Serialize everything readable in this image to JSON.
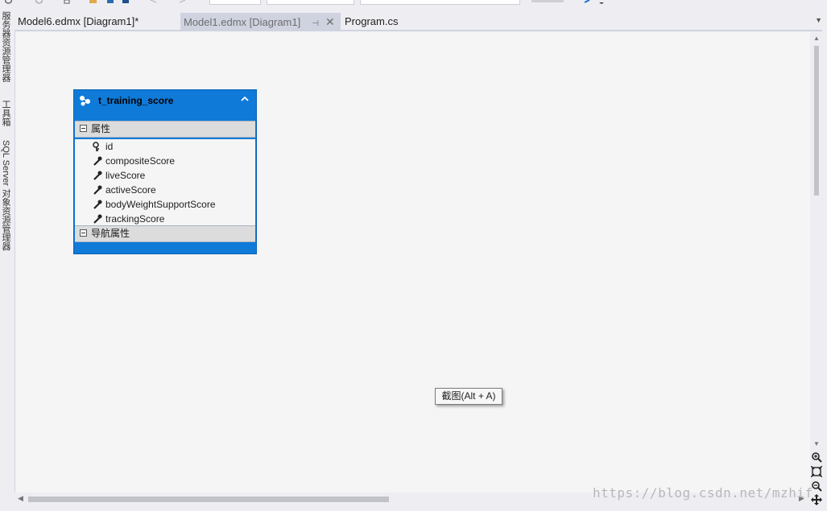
{
  "tabs": [
    {
      "label": "Model6.edmx [Diagram1]*",
      "active": false
    },
    {
      "label": "Model1.edmx [Diagram1]",
      "active": true,
      "pin_glyph": "⊣",
      "close_glyph": "✕"
    },
    {
      "label": "Program.cs",
      "active": false
    }
  ],
  "side_panels": [
    {
      "label": "服务器资源管理器"
    },
    {
      "label": "工具箱"
    },
    {
      "label": "SQL Server 对象资源管理器"
    }
  ],
  "entity": {
    "name": "t_training_score",
    "properties_section": "属性",
    "navigation_section": "导航属性",
    "properties": [
      {
        "name": "id",
        "is_key": true
      },
      {
        "name": "compositeScore",
        "is_key": false
      },
      {
        "name": "liveScore",
        "is_key": false
      },
      {
        "name": "activeScore",
        "is_key": false
      },
      {
        "name": "bodyWeightSupportScore",
        "is_key": false
      },
      {
        "name": "trackingScore",
        "is_key": false
      }
    ]
  },
  "tooltip": {
    "text": "截图(Alt + A)"
  },
  "watermark": {
    "text": "https://blog.csdn.net/mzhif"
  },
  "colors": {
    "entity_blue": "#0f7ad8",
    "canvas": "#f5f5f5",
    "chrome": "#eeeef2"
  }
}
